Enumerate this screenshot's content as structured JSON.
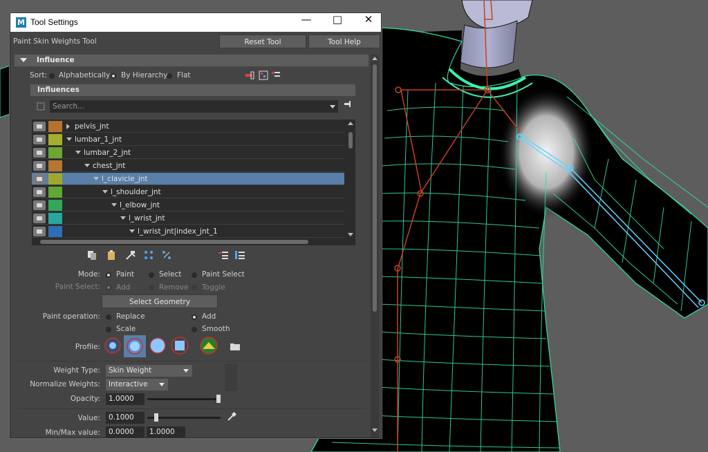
{
  "window": {
    "title": "Tool Settings",
    "app_icon_letter": "M"
  },
  "toolbar": {
    "tool_name": "Paint Skin Weights Tool",
    "reset_label": "Reset Tool",
    "help_label": "Tool Help"
  },
  "influence_section": {
    "title": "Influence",
    "sort_label": "Sort:",
    "sort_options": [
      "Alphabetically",
      "By Hierarchy",
      "Flat"
    ],
    "sort_selected": "By Hierarchy",
    "influences_header": "Influences",
    "search_placeholder": "Search...",
    "rows": [
      {
        "name": "pelvis_jnt",
        "color": "#b8722f",
        "depth": 0,
        "twisty": "closed",
        "selected": false
      },
      {
        "name": "lumbar_1_jnt",
        "color": "#a5ad2f",
        "depth": 0,
        "twisty": "open",
        "selected": false
      },
      {
        "name": "lumbar_2_jnt",
        "color": "#6ea632",
        "depth": 1,
        "twisty": "open",
        "selected": false
      },
      {
        "name": "chest_jnt",
        "color": "#b5772f",
        "depth": 2,
        "twisty": "open",
        "selected": false
      },
      {
        "name": "l_clavicle_jnt",
        "color": "#a1a72e",
        "depth": 3,
        "twisty": "open",
        "selected": true
      },
      {
        "name": "l_shoulder_jnt",
        "color": "#62a633",
        "depth": 4,
        "twisty": "open",
        "selected": false
      },
      {
        "name": "l_elbow_jnt",
        "color": "#32a65a",
        "depth": 5,
        "twisty": "open",
        "selected": false
      },
      {
        "name": "l_wrist_jnt",
        "color": "#2aa5a0",
        "depth": 6,
        "twisty": "open",
        "selected": false
      },
      {
        "name": "l_wrist_jnt|index_jnt_1",
        "color": "#2f6eb5",
        "depth": 7,
        "twisty": "open",
        "selected": false
      }
    ]
  },
  "mode": {
    "label": "Mode:",
    "options": [
      "Paint",
      "Select",
      "Paint Select"
    ],
    "selected": "Paint",
    "paint_select_label": "Paint Select:",
    "paint_select_options": [
      "Add",
      "Remove",
      "Toggle"
    ],
    "select_geometry_label": "Select Geometry"
  },
  "paint_operation": {
    "label": "Paint operation:",
    "options": [
      "Replace",
      "Add",
      "Scale",
      "Smooth"
    ],
    "selected": "Add"
  },
  "profile": {
    "label": "Profile:",
    "selected_index": 1
  },
  "weights": {
    "weight_type_label": "Weight Type:",
    "weight_type_value": "Skin Weight",
    "normalize_label": "Normalize Weights:",
    "normalize_value": "Interactive",
    "opacity_label": "Opacity:",
    "opacity_value": "1.0000",
    "opacity_fraction": 1.0,
    "value_label": "Value:",
    "value_value": "0.1000",
    "value_fraction": 0.1,
    "minmax_label": "Min/Max value:",
    "min_value": "0.0000",
    "max_value": "1.0000"
  },
  "colors": {
    "selection": "#5a7fa8",
    "panel": "#444444",
    "wireframe": "#3cf0b0",
    "joint": "#c8401e",
    "selected_joint": "#66d4ff"
  }
}
